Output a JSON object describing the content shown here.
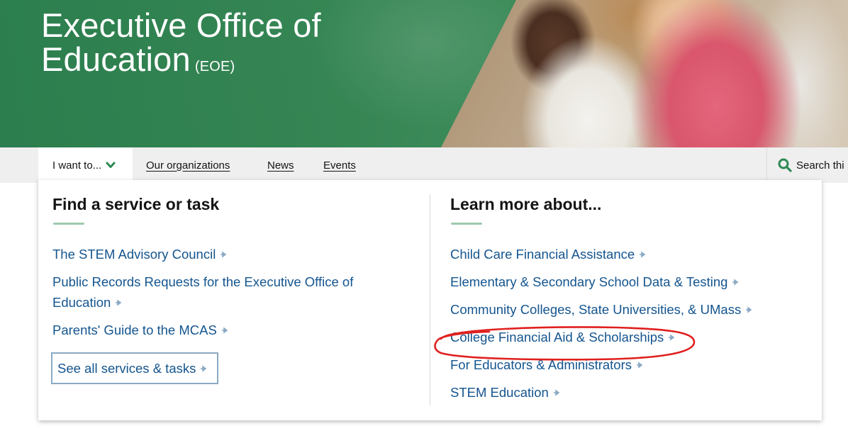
{
  "hero": {
    "title_line1": "Executive Office of",
    "title_line2": "Education",
    "abbreviation": "(EOE)",
    "brand_color": "#2e8a55"
  },
  "nav": {
    "i_want_to": "I want to...",
    "items": [
      "Our organizations",
      "News",
      "Events"
    ],
    "search_label": "Search thi"
  },
  "panel": {
    "left": {
      "heading": "Find a service or task",
      "links": [
        "The STEM Advisory Council",
        "Public Records Requests for the Executive Office of Education",
        "Parents' Guide to the MCAS"
      ],
      "see_all": "See all services & tasks"
    },
    "right": {
      "heading": "Learn more about...",
      "links": [
        "Child Care Financial Assistance",
        "Elementary & Secondary School Data & Testing",
        "Community Colleges, State Universities, & UMass",
        "College Financial Aid & Scholarships",
        "For Educators & Administrators",
        "STEM Education"
      ],
      "highlighted_link": "College Financial Aid & Scholarships"
    },
    "link_color": "#14558f",
    "arrow_color": "#8aa9c4",
    "highlight_color": "#e0201f"
  }
}
